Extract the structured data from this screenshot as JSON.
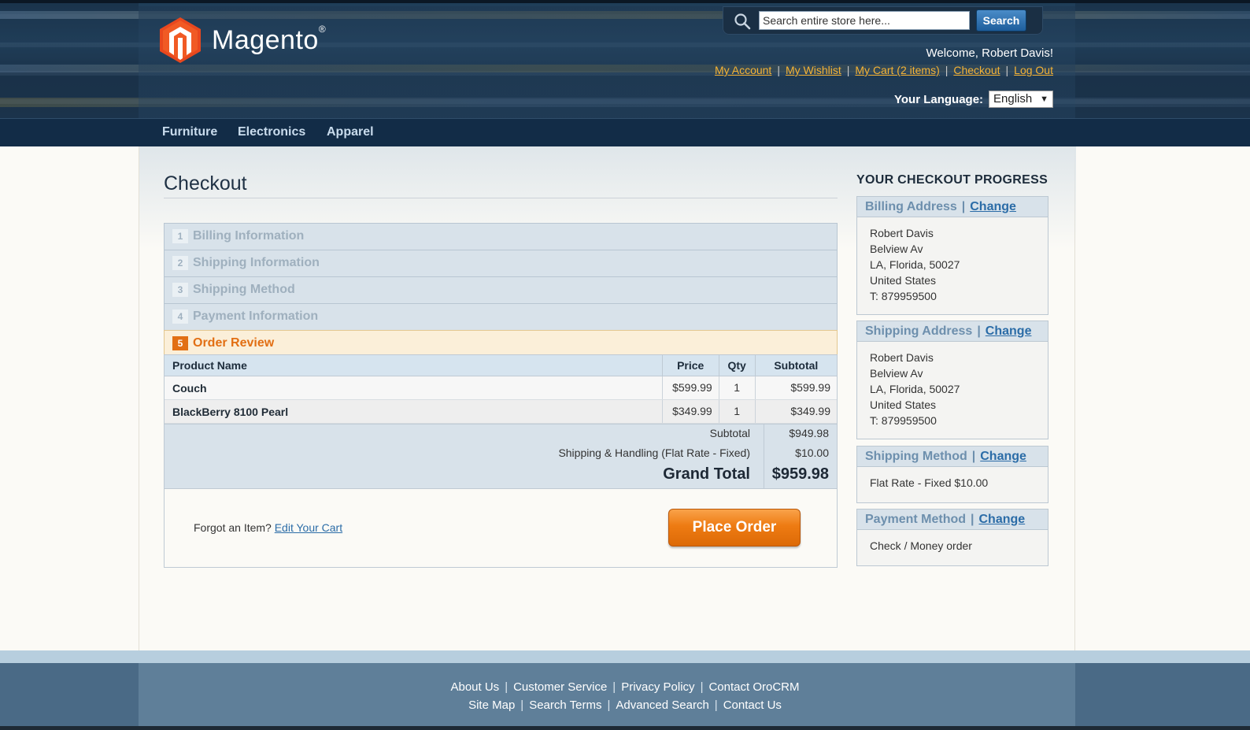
{
  "header": {
    "logo_text": "Magento",
    "logo_reg": "®",
    "search_placeholder": "Search entire store here...",
    "search_button": "Search",
    "welcome": "Welcome, Robert Davis!",
    "links": [
      "My Account",
      "My Wishlist",
      "My Cart (2 items)",
      "Checkout",
      "Log Out"
    ],
    "language_label": "Your Language:",
    "language_value": "English"
  },
  "nav": [
    "Furniture",
    "Electronics",
    "Apparel"
  ],
  "page_title": "Checkout",
  "steps": [
    {
      "num": "1",
      "label": "Billing Information"
    },
    {
      "num": "2",
      "label": "Shipping Information"
    },
    {
      "num": "3",
      "label": "Shipping Method"
    },
    {
      "num": "4",
      "label": "Payment Information"
    },
    {
      "num": "5",
      "label": "Order Review"
    }
  ],
  "review": {
    "columns": [
      "Product Name",
      "Price",
      "Qty",
      "Subtotal"
    ],
    "items": [
      {
        "name": "Couch",
        "price": "$599.99",
        "qty": "1",
        "subtotal": "$599.99"
      },
      {
        "name": "BlackBerry 8100 Pearl",
        "price": "$349.99",
        "qty": "1",
        "subtotal": "$349.99"
      }
    ],
    "subtotal_label": "Subtotal",
    "subtotal_value": "$949.98",
    "shipping_label": "Shipping & Handling (Flat Rate - Fixed)",
    "shipping_value": "$10.00",
    "grand_label": "Grand Total",
    "grand_value": "$959.98",
    "forgot_text": "Forgot an Item?",
    "edit_cart": "Edit Your Cart",
    "place_order": "Place Order"
  },
  "progress": {
    "title": "YOUR CHECKOUT PROGRESS",
    "change": "Change",
    "billing_title": "Billing Address",
    "billing_lines": [
      "Robert Davis",
      "Belview Av",
      "LA, Florida, 50027",
      "United States",
      "T: 879959500"
    ],
    "shipping_title": "Shipping Address",
    "shipping_lines": [
      "Robert Davis",
      "Belview Av",
      "LA, Florida, 50027",
      "United States",
      "T: 879959500"
    ],
    "method_title": "Shipping Method",
    "method_value": "Flat Rate - Fixed $10.00",
    "payment_title": "Payment Method",
    "payment_value": "Check / Money order"
  },
  "footer": {
    "row1": [
      "About Us",
      "Customer Service",
      "Privacy Policy",
      "Contact OroCRM"
    ],
    "row2": [
      "Site Map",
      "Search Terms",
      "Advanced Search",
      "Contact Us"
    ]
  },
  "colors": {
    "accent": "#e26f14",
    "link": "#2b6ca7",
    "header_link": "#f5b335",
    "nav_bg": "#122c47"
  }
}
